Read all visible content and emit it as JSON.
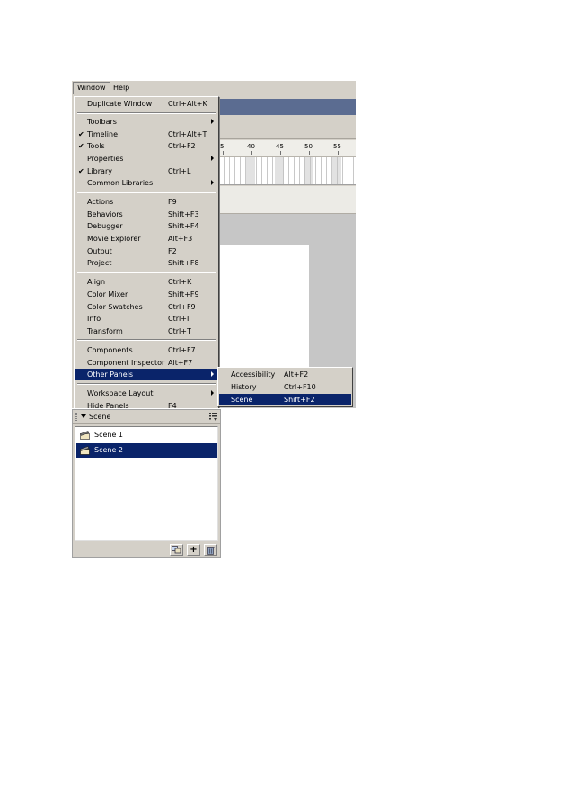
{
  "menubar": {
    "window_label": "Window",
    "help_label": "Help"
  },
  "window_menu": {
    "items": [
      {
        "label": "Duplicate Window",
        "shortcut": "Ctrl+Alt+K"
      },
      {
        "label": "Toolbars",
        "shortcut": ""
      },
      {
        "label": "Timeline",
        "shortcut": "Ctrl+Alt+T",
        "checked": true
      },
      {
        "label": "Tools",
        "shortcut": "Ctrl+F2",
        "checked": true
      },
      {
        "label": "Properties",
        "shortcut": ""
      },
      {
        "label": "Library",
        "shortcut": "Ctrl+L",
        "checked": true
      },
      {
        "label": "Common Libraries",
        "shortcut": ""
      },
      {
        "label": "Actions",
        "shortcut": "F9"
      },
      {
        "label": "Behaviors",
        "shortcut": "Shift+F3"
      },
      {
        "label": "Debugger",
        "shortcut": "Shift+F4"
      },
      {
        "label": "Movie Explorer",
        "shortcut": "Alt+F3"
      },
      {
        "label": "Output",
        "shortcut": "F2"
      },
      {
        "label": "Project",
        "shortcut": "Shift+F8"
      },
      {
        "label": "Align",
        "shortcut": "Ctrl+K"
      },
      {
        "label": "Color Mixer",
        "shortcut": "Shift+F9"
      },
      {
        "label": "Color Swatches",
        "shortcut": "Ctrl+F9"
      },
      {
        "label": "Info",
        "shortcut": "Ctrl+I"
      },
      {
        "label": "Transform",
        "shortcut": "Ctrl+T"
      },
      {
        "label": "Components",
        "shortcut": "Ctrl+F7"
      },
      {
        "label": "Component Inspector",
        "shortcut": "Alt+F7"
      },
      {
        "label": "Other Panels",
        "shortcut": ""
      },
      {
        "label": "Workspace Layout",
        "shortcut": ""
      },
      {
        "label": "Hide Panels",
        "shortcut": "F4"
      }
    ],
    "check_mark": "✔"
  },
  "other_panels_submenu": {
    "items": [
      {
        "label": "Accessibility",
        "shortcut": "Alt+F2"
      },
      {
        "label": "History",
        "shortcut": "Ctrl+F10"
      },
      {
        "label": "Scene",
        "shortcut": "Shift+F2"
      }
    ]
  },
  "timeline": {
    "ruler_labels": [
      "5",
      "40",
      "45",
      "50",
      "55"
    ]
  },
  "scene_panel": {
    "title": "Scene",
    "scenes": [
      {
        "label": "Scene 1",
        "selected": false
      },
      {
        "label": "Scene 2",
        "selected": true
      }
    ],
    "footer_buttons": {
      "duplicate_icon": "duplicate-scene-icon",
      "add_label": "+",
      "delete_icon": "trash-icon"
    }
  },
  "colors": {
    "highlight": "#0a246a",
    "chrome": "#d4d0c8",
    "title_strip": "#5b6c91"
  }
}
